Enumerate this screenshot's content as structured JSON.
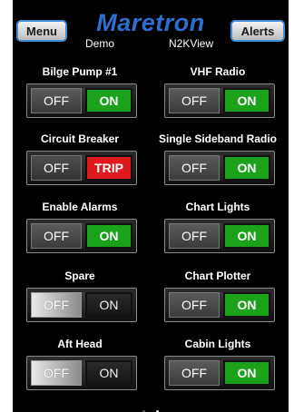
{
  "header": {
    "menu_label": "Menu",
    "alerts_label": "Alerts",
    "logo_text": "Maretron",
    "left_subtitle": "Demo",
    "right_subtitle": "N2KView"
  },
  "switches": [
    {
      "label": "Bilge Pump #1",
      "off_label": "OFF",
      "on_label": "ON",
      "state": "on"
    },
    {
      "label": "VHF Radio",
      "off_label": "OFF",
      "on_label": "ON",
      "state": "on"
    },
    {
      "label": "Circuit Breaker",
      "off_label": "OFF",
      "on_label": "TRIP",
      "state": "trip"
    },
    {
      "label": "Single Sideband Radio",
      "off_label": "OFF",
      "on_label": "ON",
      "state": "on"
    },
    {
      "label": "Enable Alarms",
      "off_label": "OFF",
      "on_label": "ON",
      "state": "on"
    },
    {
      "label": "Chart Lights",
      "off_label": "OFF",
      "on_label": "ON",
      "state": "on"
    },
    {
      "label": "Spare",
      "off_label": "OFF",
      "on_label": "ON",
      "state": "off"
    },
    {
      "label": "Chart Plotter",
      "off_label": "OFF",
      "on_label": "ON",
      "state": "on"
    },
    {
      "label": "Aft Head",
      "off_label": "OFF",
      "on_label": "ON",
      "state": "off"
    },
    {
      "label": "Cabin Lights",
      "off_label": "OFF",
      "on_label": "ON",
      "state": "on"
    }
  ],
  "pager": {
    "page_count": 2,
    "active_page": 2
  },
  "colors": {
    "on": "#1aa31a",
    "trip": "#e0191e",
    "logo": "#2f6fd0",
    "button_border": "#3f8fd8"
  }
}
